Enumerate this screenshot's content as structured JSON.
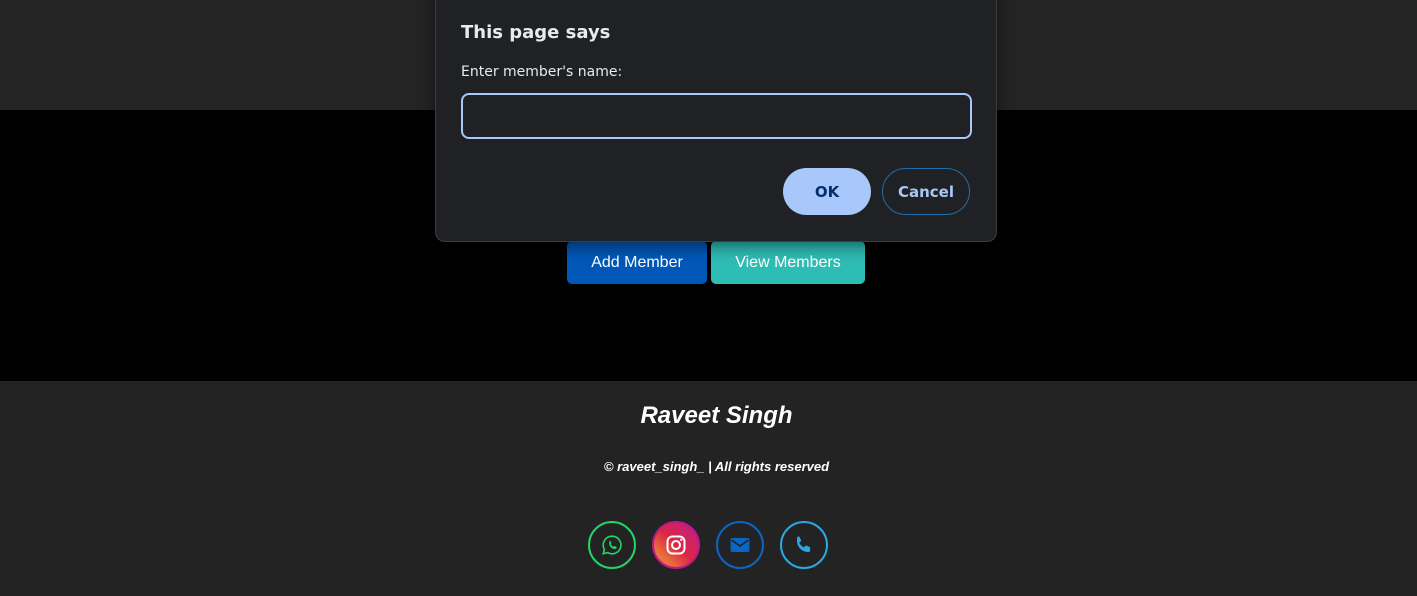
{
  "dialog": {
    "title": "This page says",
    "message": "Enter member's name:",
    "input_value": "",
    "ok_label": "OK",
    "cancel_label": "Cancel"
  },
  "main": {
    "add_member_label": "Add Member",
    "view_members_label": "View Members"
  },
  "footer": {
    "name": "Raveet Singh",
    "copyright": "© raveet_singh_ | All rights reserved",
    "socials": [
      {
        "icon": "whatsapp-icon",
        "color": "#25d366"
      },
      {
        "icon": "instagram-icon",
        "color": "#e1306c"
      },
      {
        "icon": "mail-icon",
        "color": "#0a66c2"
      },
      {
        "icon": "phone-icon",
        "color": "#2aa8e0"
      }
    ]
  },
  "colors": {
    "dialog_accent": "#a8c7fa",
    "add_button": "#0057b8",
    "view_button": "#2ebdb5"
  }
}
